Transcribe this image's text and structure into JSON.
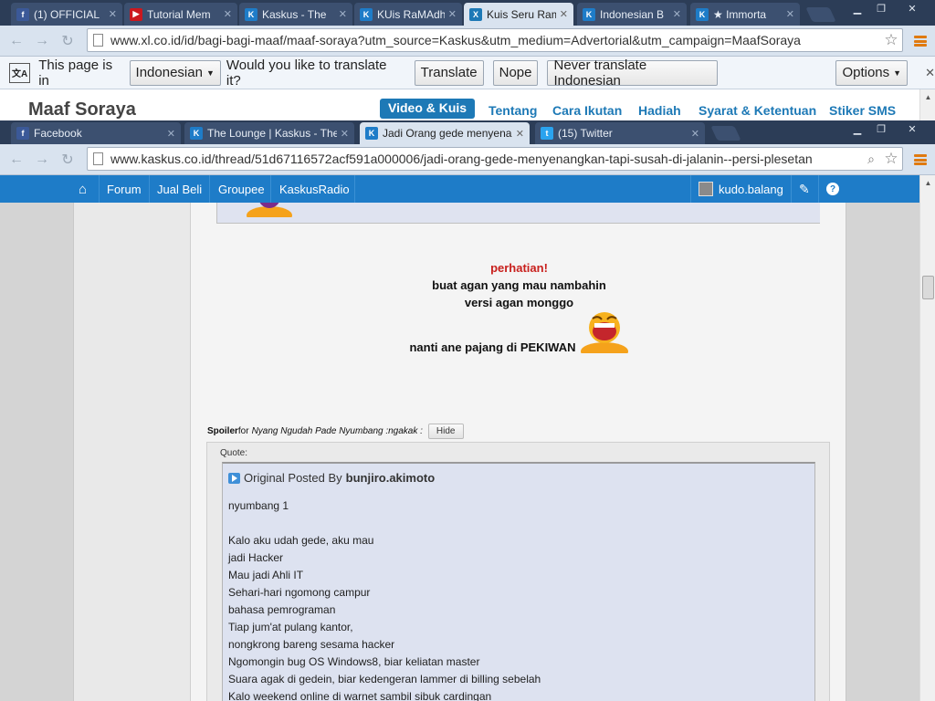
{
  "window_back": {
    "tabs": [
      {
        "label": "(1) OFFICIAL",
        "icon": "facebook-icon",
        "color": "#3b5998"
      },
      {
        "label": "Tutorial Mem",
        "icon": "youtube-icon",
        "color": "#cc181e"
      },
      {
        "label": "Kaskus - The",
        "icon": "kaskus-icon",
        "color": "#1e7cc8"
      },
      {
        "label": "KUis RaMAdh",
        "icon": "kaskus-icon",
        "color": "#1e7cc8"
      },
      {
        "label": "Kuis Seru Ram",
        "icon": "xl-icon",
        "color": "#1d79b6",
        "active": true
      },
      {
        "label": "Indonesian B",
        "icon": "kaskus-icon",
        "color": "#1e7cc8"
      },
      {
        "label": "★ Immorta",
        "icon": "kaskus-icon",
        "color": "#1e7cc8"
      }
    ],
    "url": "www.xl.co.id/id/bagi-bagi-maaf/maaf-soraya?utm_source=Kaskus&utm_medium=Advertorial&utm_campaign=MaafSoraya",
    "translate_bar": {
      "prefix": "This page is in",
      "language": "Indonesian",
      "question": "Would you like to translate it?",
      "translate": "Translate",
      "nope": "Nope",
      "never": "Never translate Indonesian",
      "options": "Options"
    },
    "site": {
      "title": "Maaf Soraya",
      "nav": [
        "Video & Kuis",
        "Tentang",
        "Cara Ikutan",
        "Hadiah",
        "Syarat & Ketentuan",
        "Stiker SMS"
      ]
    }
  },
  "window_front": {
    "tabs": [
      {
        "label": "Facebook",
        "icon": "facebook-icon",
        "color": "#3b5998"
      },
      {
        "label": "The Lounge | Kaskus - The",
        "icon": "kaskus-icon",
        "color": "#1e7cc8"
      },
      {
        "label": "Jadi Orang gede menyenang",
        "icon": "kaskus-icon",
        "color": "#1e7cc8",
        "active": true
      },
      {
        "label": "(15) Twitter",
        "icon": "twitter-icon",
        "color": "#2aa3ef"
      }
    ],
    "url": "www.kaskus.co.id/thread/51d67116572acf591a000006/jadi-orang-gede-menyenangkan-tapi-susah-di-jalanin--persi-plesetan",
    "kaskus_nav": {
      "items": [
        "Forum",
        "Jual Beli",
        "Groupee",
        "KaskusRadio"
      ],
      "user": "kudo.balang"
    }
  },
  "post": {
    "perhatian": "perhatian!",
    "line1": "buat agan yang mau nambahin",
    "line2": "versi agan monggo",
    "line3": "nanti ane pajang di PEKIWAN",
    "spoiler_label": "Spoiler",
    "spoiler_for": "for",
    "spoiler_title": "Nyang Ngudah Pade Nyumbang :ngakak :",
    "hide": "Hide",
    "quote_label": "Quote:",
    "original_posted_by": "Original Posted By",
    "quote_author": "bunjiro.akimoto",
    "quote_lines": [
      "nyumbang 1",
      "",
      "Kalo aku udah gede, aku mau",
      "jadi Hacker",
      "Mau jadi Ahli IT",
      "Sehari-hari ngomong campur",
      "bahasa pemrograman",
      "Tiap jum'at pulang kantor,",
      "nongkrong bareng sesama hacker",
      "Ngomongin bug OS Windows8, biar keliatan master",
      "Suara agak di gedein, biar kedengeran lammer di billing sebelah",
      "Kalo weekend online di warnet sambil sibuk cardingan"
    ]
  }
}
